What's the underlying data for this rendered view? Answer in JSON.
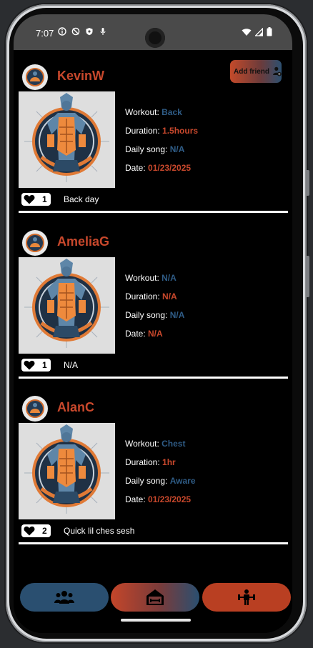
{
  "status_bar": {
    "time": "7:07",
    "left_icons": [
      "info-icon",
      "no-sync-icon",
      "shield-icon",
      "mic-icon"
    ],
    "right_icons": [
      "wifi-icon",
      "signal-icon",
      "battery-icon"
    ]
  },
  "header": {
    "add_friend_label": "Add friend"
  },
  "feed": {
    "posts": [
      {
        "username": "KevinW",
        "workout_label": "Workout: ",
        "workout": "Back",
        "duration_label": "Duration: ",
        "duration": "1.5hours",
        "song_label": "Daily song: ",
        "song": "N/A",
        "date_label": "Date: ",
        "date": "01/23/2025",
        "likes": "1",
        "caption": "Back day"
      },
      {
        "username": "AmeliaG",
        "workout_label": "Workout: ",
        "workout": "N/A",
        "duration_label": "Duration: ",
        "duration": "N/A",
        "song_label": "Daily song: ",
        "song": "N/A",
        "date_label": "Date: ",
        "date": "N/A",
        "likes": "1",
        "caption": "N/A"
      },
      {
        "username": "AlanC",
        "workout_label": "Workout: ",
        "workout": "Chest",
        "duration_label": "Duration: ",
        "duration": "1hr",
        "song_label": "Daily song: ",
        "song": "Aware",
        "date_label": "Date: ",
        "date": "01/23/2025",
        "likes": "2",
        "caption": "Quick lil ches sesh"
      }
    ]
  },
  "bottom_nav": {
    "items": [
      "friends-icon",
      "gym-home-icon",
      "weightlifter-icon"
    ]
  },
  "colors": {
    "accent_red": "#c8482c",
    "accent_blue": "#2f5c86",
    "background": "#000000"
  }
}
